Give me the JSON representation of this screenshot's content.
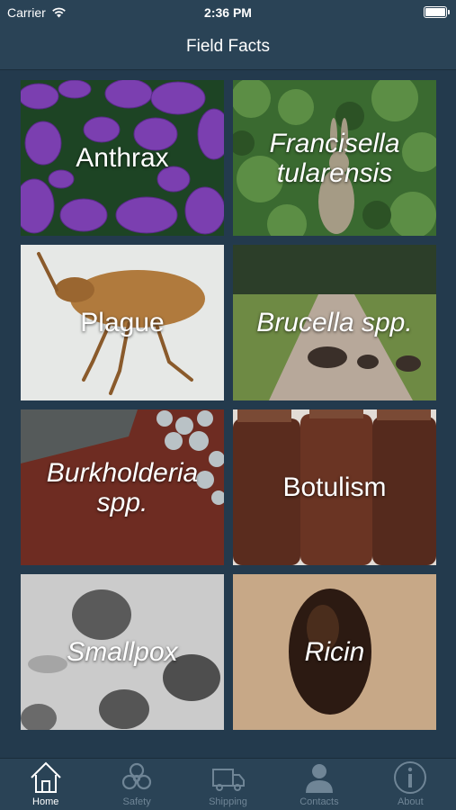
{
  "status_bar": {
    "carrier": "Carrier",
    "time": "2:36 PM",
    "icons": [
      "wifi-icon",
      "battery-icon"
    ]
  },
  "nav": {
    "title": "Field Facts"
  },
  "tiles": [
    {
      "label": "Anthrax",
      "italic": false
    },
    {
      "label": "Francisella tularensis",
      "italic": true
    },
    {
      "label": "Plague",
      "italic": false
    },
    {
      "label": "Brucella spp.",
      "italic": true
    },
    {
      "label": "Burkholderia spp.",
      "italic": true
    },
    {
      "label": "Botulism",
      "italic": false
    },
    {
      "label": "Smallpox",
      "italic": true
    },
    {
      "label": "Ricin",
      "italic": true
    }
  ],
  "tab_bar": {
    "active": "Home",
    "tabs": [
      {
        "label": "Home",
        "icon": "home-icon"
      },
      {
        "label": "Safety",
        "icon": "biohazard-icon"
      },
      {
        "label": "Shipping",
        "icon": "truck-icon"
      },
      {
        "label": "Contacts",
        "icon": "person-icon"
      },
      {
        "label": "About",
        "icon": "info-icon"
      }
    ]
  },
  "colors": {
    "background": "#233a4d",
    "bar": "#2a4356",
    "tab_inactive": "#6f8596",
    "tab_active": "#ffffff"
  }
}
